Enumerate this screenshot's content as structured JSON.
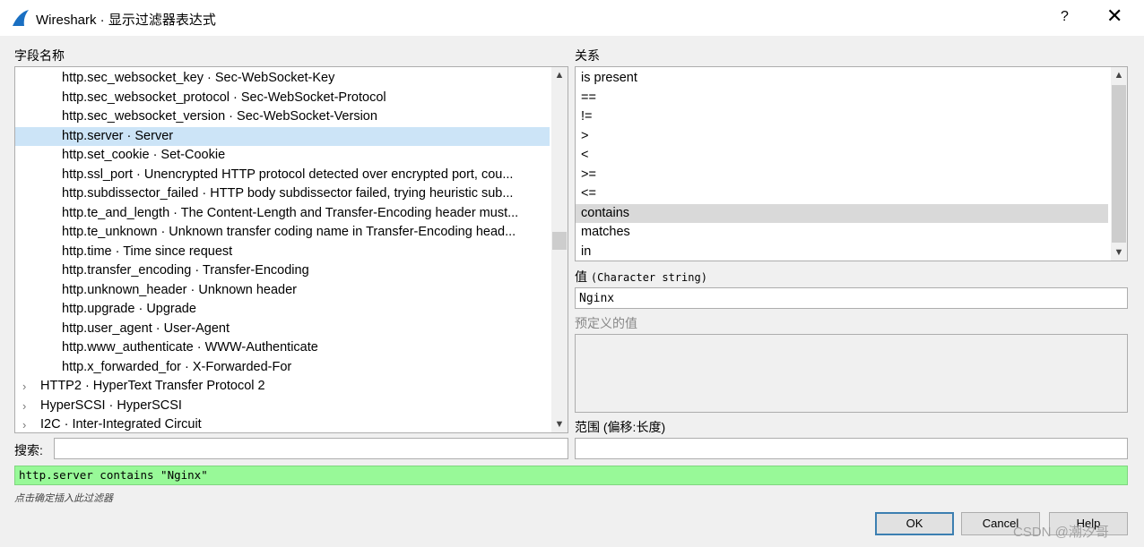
{
  "window": {
    "title": "Wireshark · 显示过滤器表达式",
    "help_glyph": "?",
    "close_glyph": "✕"
  },
  "field_panel": {
    "label": "字段名称",
    "rows": [
      {
        "text": "http.sec_websocket_key · Sec-WebSocket-Key",
        "indent": "child",
        "selected": false
      },
      {
        "text": "http.sec_websocket_protocol · Sec-WebSocket-Protocol",
        "indent": "child",
        "selected": false
      },
      {
        "text": "http.sec_websocket_version · Sec-WebSocket-Version",
        "indent": "child",
        "selected": false
      },
      {
        "text": "http.server · Server",
        "indent": "child",
        "selected": true
      },
      {
        "text": "http.set_cookie · Set-Cookie",
        "indent": "child",
        "selected": false
      },
      {
        "text": "http.ssl_port · Unencrypted HTTP protocol detected over encrypted port, cou...",
        "indent": "child",
        "selected": false
      },
      {
        "text": "http.subdissector_failed · HTTP body subdissector failed, trying heuristic sub...",
        "indent": "child",
        "selected": false
      },
      {
        "text": "http.te_and_length · The Content-Length and Transfer-Encoding header must...",
        "indent": "child",
        "selected": false
      },
      {
        "text": "http.te_unknown · Unknown transfer coding name in Transfer-Encoding head...",
        "indent": "child",
        "selected": false
      },
      {
        "text": "http.time · Time since request",
        "indent": "child",
        "selected": false
      },
      {
        "text": "http.transfer_encoding · Transfer-Encoding",
        "indent": "child",
        "selected": false
      },
      {
        "text": "http.unknown_header · Unknown header",
        "indent": "child",
        "selected": false
      },
      {
        "text": "http.upgrade · Upgrade",
        "indent": "child",
        "selected": false
      },
      {
        "text": "http.user_agent · User-Agent",
        "indent": "child",
        "selected": false
      },
      {
        "text": "http.www_authenticate · WWW-Authenticate",
        "indent": "child",
        "selected": false
      },
      {
        "text": "http.x_forwarded_for · X-Forwarded-For",
        "indent": "child",
        "selected": false
      },
      {
        "text": "HTTP2 · HyperText Transfer Protocol 2",
        "indent": "top",
        "selected": false
      },
      {
        "text": "HyperSCSI · HyperSCSI",
        "indent": "top",
        "selected": false
      },
      {
        "text": "I2C · Inter-Integrated Circuit",
        "indent": "top",
        "selected": false
      }
    ],
    "expand_glyph": "›"
  },
  "relation_panel": {
    "label": "关系",
    "rows": [
      {
        "text": "is present",
        "selected": false
      },
      {
        "text": "==",
        "selected": false
      },
      {
        "text": "!=",
        "selected": false
      },
      {
        "text": ">",
        "selected": false
      },
      {
        "text": "<",
        "selected": false
      },
      {
        "text": ">=",
        "selected": false
      },
      {
        "text": "<=",
        "selected": false
      },
      {
        "text": "contains",
        "selected": true
      },
      {
        "text": "matches",
        "selected": false
      },
      {
        "text": "in",
        "selected": false
      }
    ]
  },
  "value": {
    "label_prefix": "值",
    "label_type": "(Character string)",
    "input_value": "Nginx"
  },
  "predefined": {
    "label": "预定义的值"
  },
  "range": {
    "label": "范围 (偏移:长度)",
    "input_value": ""
  },
  "search": {
    "label": "搜索:",
    "input_value": ""
  },
  "filter_expression": "http.server contains \"Nginx\"",
  "hint": "点击确定插入此过滤器",
  "buttons": {
    "ok": "OK",
    "cancel": "Cancel",
    "help": "Help"
  },
  "watermark": "CSDN @潮汐哥",
  "colors": {
    "selection": "#cce4f7",
    "filter_valid": "#98f998",
    "brand_fin": "#1a6fc2"
  },
  "icons": {
    "title": "wireshark-fin-icon",
    "scroll_up": "chevron-up-icon",
    "scroll_down": "chevron-down-icon"
  }
}
